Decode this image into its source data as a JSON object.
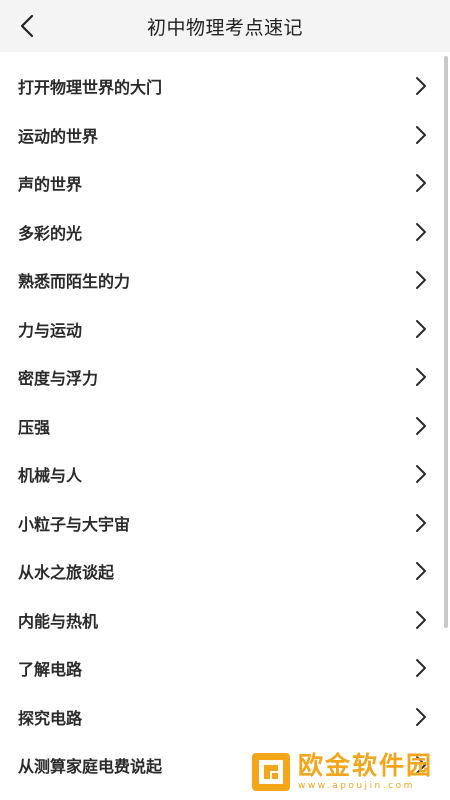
{
  "header": {
    "title": "初中物理考点速记",
    "back_icon": "chevron-left-icon"
  },
  "list": {
    "items": [
      {
        "label": "打开物理世界的大门"
      },
      {
        "label": "运动的世界"
      },
      {
        "label": "声的世界"
      },
      {
        "label": "多彩的光"
      },
      {
        "label": "熟悉而陌生的力"
      },
      {
        "label": "力与运动"
      },
      {
        "label": "密度与浮力"
      },
      {
        "label": "压强"
      },
      {
        "label": "机械与人"
      },
      {
        "label": "小粒子与大宇宙"
      },
      {
        "label": "从水之旅谈起"
      },
      {
        "label": "内能与热机"
      },
      {
        "label": "了解电路"
      },
      {
        "label": "探究电路"
      },
      {
        "label": "从测算家庭电费说起"
      }
    ],
    "chevron_icon": "chevron-right-icon"
  },
  "watermark": {
    "name": "欧金软件园",
    "url": "www.apoujin.com",
    "color": "#f3a51c"
  },
  "colors": {
    "header_bg": "#f4f4f4",
    "text": "#2a2a2a",
    "accent": "#f3a51c"
  }
}
